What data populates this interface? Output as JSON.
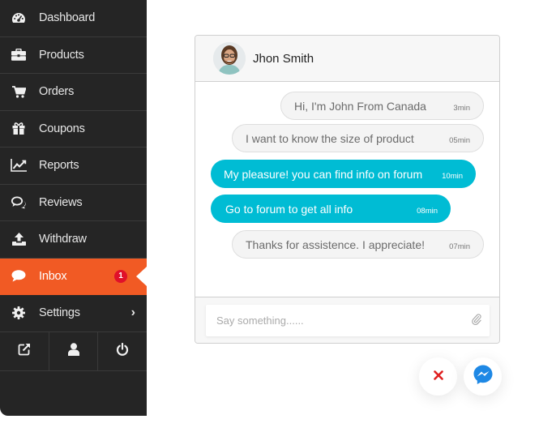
{
  "sidebar": {
    "items": [
      {
        "label": "Dashboard",
        "icon": "dashboard-icon"
      },
      {
        "label": "Products",
        "icon": "briefcase-icon"
      },
      {
        "label": "Orders",
        "icon": "cart-icon"
      },
      {
        "label": "Coupons",
        "icon": "gift-icon"
      },
      {
        "label": "Reports",
        "icon": "line-chart-icon"
      },
      {
        "label": "Reviews",
        "icon": "comments-icon"
      },
      {
        "label": "Withdraw",
        "icon": "upload-icon"
      },
      {
        "label": "Inbox",
        "icon": "comment-icon",
        "active": true,
        "badge": "1"
      },
      {
        "label": "Settings",
        "icon": "gear-icon",
        "chevron": "›"
      }
    ],
    "bottom_buttons": [
      {
        "icon": "external-link-icon"
      },
      {
        "icon": "user-icon"
      },
      {
        "icon": "power-icon"
      }
    ]
  },
  "chat": {
    "contact_name": "Jhon Smith",
    "messages": [
      {
        "text": "Hi, I'm John From Canada",
        "time": "3min",
        "direction": "in"
      },
      {
        "text": "I want to know the size of product",
        "time": "05min",
        "direction": "in"
      },
      {
        "text": "My pleasure! you can find info on forum",
        "time": "10min",
        "direction": "out"
      },
      {
        "text": "Go to forum to get all info",
        "time": "08min",
        "direction": "out"
      },
      {
        "text": "Thanks for assistence. I appreciate!",
        "time": "07min",
        "direction": "in"
      }
    ],
    "composer": {
      "placeholder": "Say something......",
      "value": ""
    }
  },
  "floating": {
    "close_icon": "close-icon",
    "messenger_icon": "messenger-icon"
  },
  "colors": {
    "sidebar_bg": "#252525",
    "active": "#f15a24",
    "badge": "#e0102a",
    "outgoing_bubble": "#00bcd4",
    "close_red": "#e02020",
    "messenger_blue": "#1e88e5"
  }
}
